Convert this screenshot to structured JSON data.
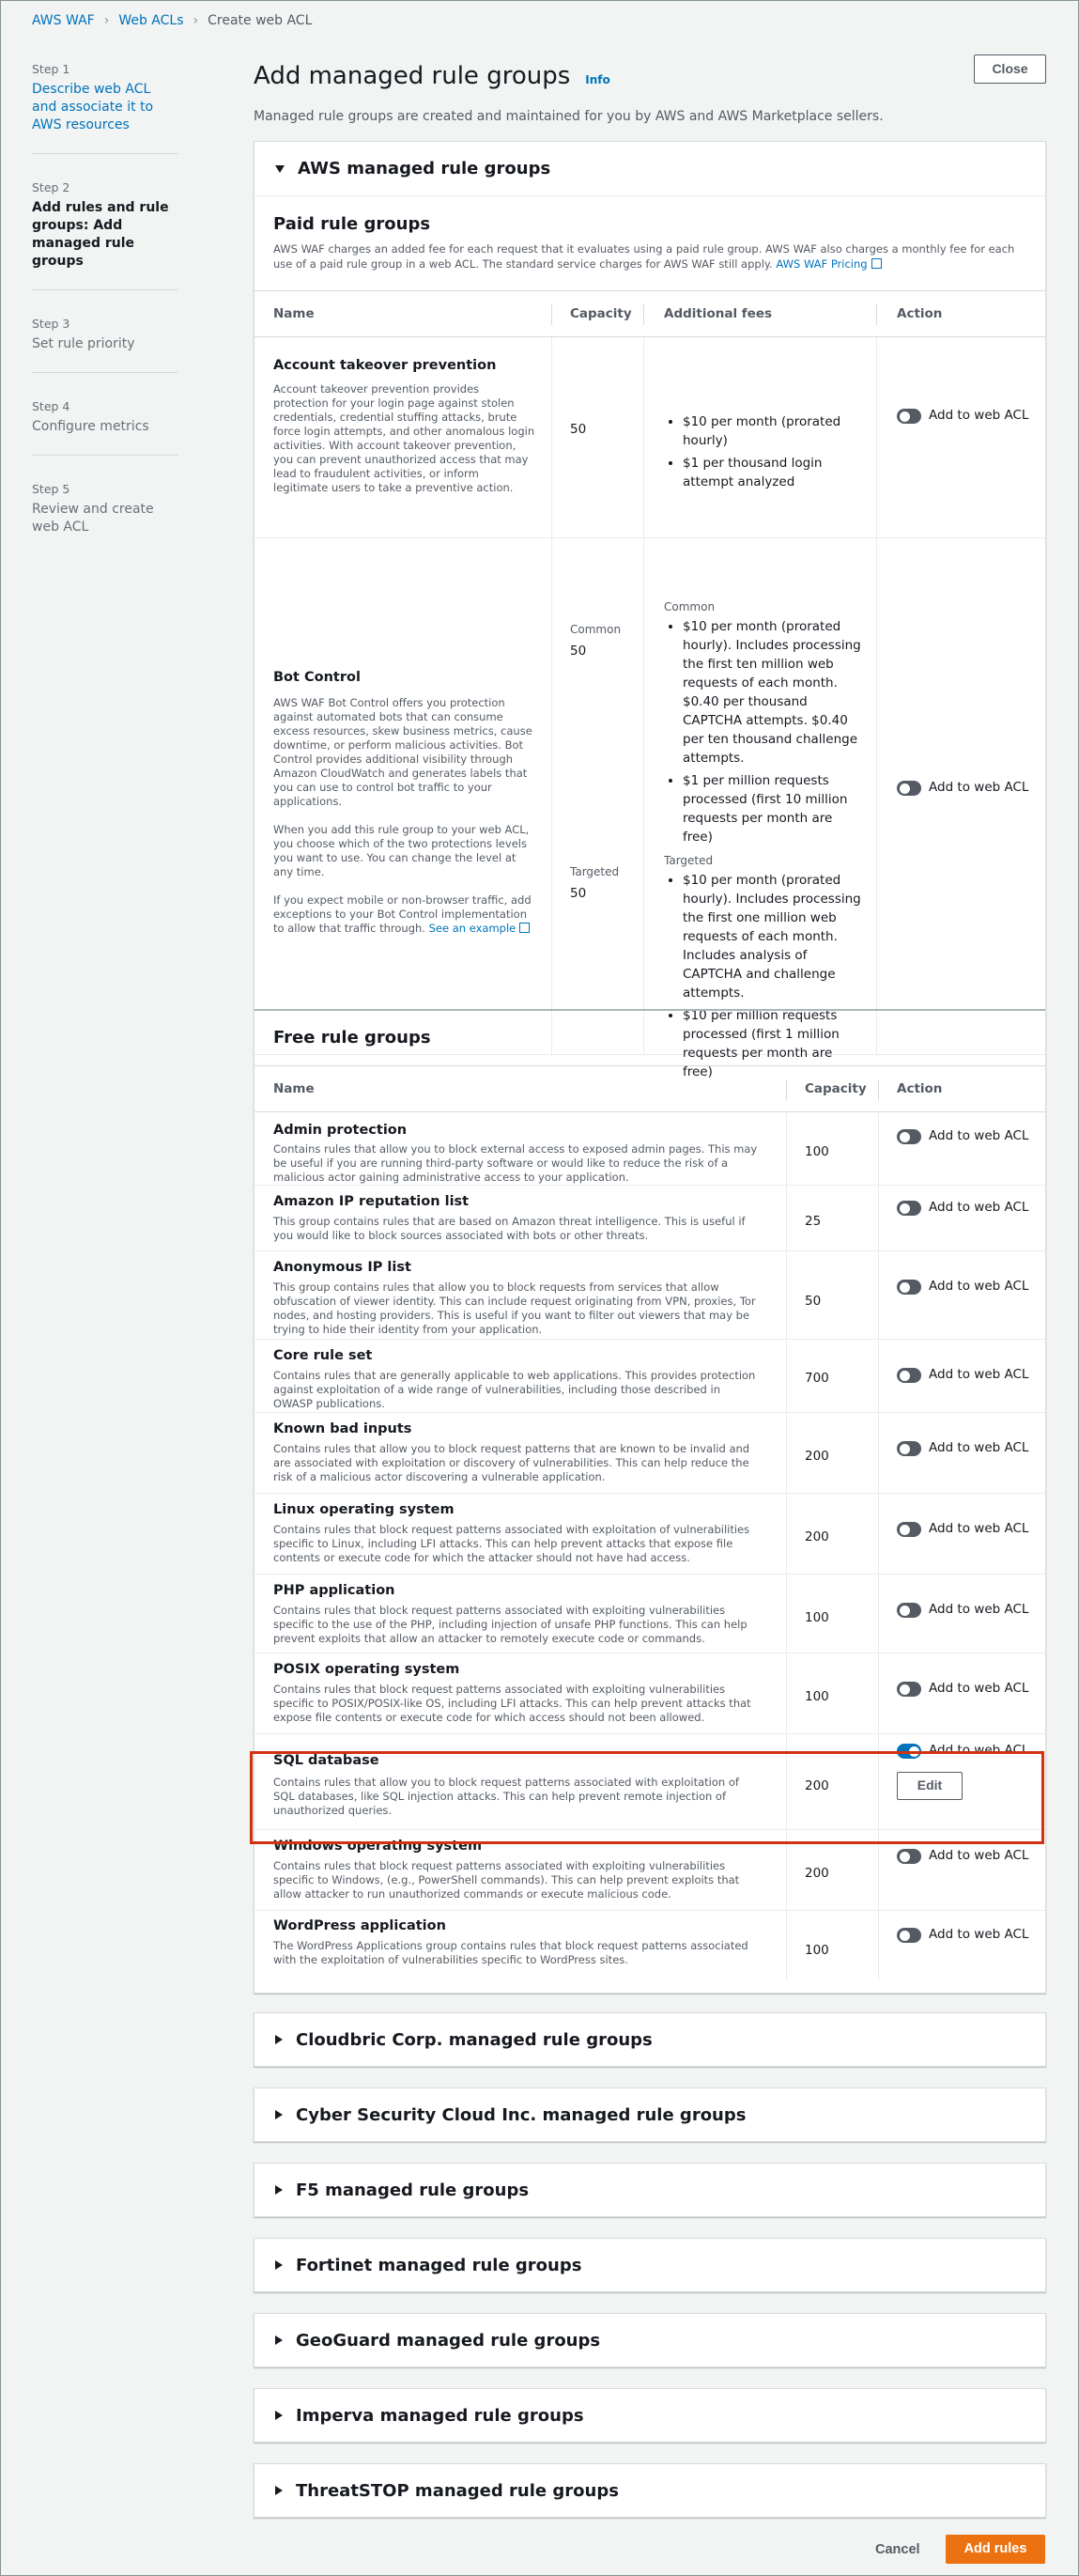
{
  "breadcrumb": [
    "AWS WAF",
    "Web ACLs",
    "Create web ACL"
  ],
  "steps": [
    {
      "num": "Step 1",
      "title": "Describe web ACL and associate it to AWS resources"
    },
    {
      "num": "Step 2",
      "title": "Add rules and rule groups: Add managed rule groups"
    },
    {
      "num": "Step 3",
      "title": "Set rule priority"
    },
    {
      "num": "Step 4",
      "title": "Configure metrics"
    },
    {
      "num": "Step 5",
      "title": "Review and create web ACL"
    }
  ],
  "page": {
    "title": "Add managed rule groups",
    "info": "Info",
    "close": "Close",
    "description": "Managed rule groups are created and maintained for you by AWS and AWS Marketplace sellers."
  },
  "aws_section": {
    "title": "AWS managed rule groups",
    "paid": {
      "title": "Paid rule groups",
      "description": "AWS WAF charges an added fee for each request that it evaluates using a paid rule group. AWS WAF also charges a monthly fee for each use of a paid rule group in a web ACL. The standard service charges for AWS WAF still apply.",
      "pricing_link": "AWS WAF Pricing",
      "columns": [
        "Name",
        "Capacity",
        "Additional fees",
        "Action"
      ],
      "rows": [
        {
          "name": "Account takeover prevention",
          "desc": "Account takeover prevention provides protection for your login page against stolen credentials, credential stuffing attacks, brute force login attempts, and other anomalous login activities. With account takeover prevention, you can prevent unauthorized access that may lead to fraudulent activities, or inform legitimate users to take a preventive action.",
          "capacity": "50",
          "fees": [
            "$10 per month (prorated hourly)",
            "$1 per thousand login attempt analyzed"
          ],
          "action": "Add to web ACL"
        },
        {
          "name": "Bot Control",
          "desc1": "AWS WAF Bot Control offers you protection against automated bots that can consume excess resources, skew business metrics, cause downtime, or perform malicious activities. Bot Control provides additional visibility through Amazon CloudWatch and generates labels that you can use to control bot traffic to your applications.",
          "desc2": "When you add this rule group to your web ACL, you choose which of the two protections levels you want to use. You can change the level at any time.",
          "desc3": "If you expect mobile or non-browser traffic, add exceptions to your Bot Control implementation to allow that traffic through.",
          "example_link": "See an example",
          "common_label": "Common",
          "common_capacity": "50",
          "common_fees": [
            "$10 per month (prorated hourly). Includes processing the first ten million web requests of each month. $0.40 per thousand CAPTCHA attempts. $0.40 per ten thousand challenge attempts.",
            "$1 per million requests processed (first 10 million requests per month are free)"
          ],
          "targeted_label": "Targeted",
          "targeted_capacity": "50",
          "targeted_fees": [
            "$10 per month (prorated hourly). Includes processing the first one million web requests of each month. Includes analysis of CAPTCHA and challenge attempts.",
            "$10 per million requests processed (first 1 million requests per month are free)"
          ],
          "action": "Add to web ACL"
        }
      ]
    },
    "free": {
      "title": "Free rule groups",
      "columns": [
        "Name",
        "Capacity",
        "Action"
      ],
      "rows": [
        {
          "name": "Admin protection",
          "desc": "Contains rules that allow you to block external access to exposed admin pages. This may be useful if you are running third-party software or would like to reduce the risk of a malicious actor gaining administrative access to your application.",
          "capacity": "100",
          "action": "Add to web ACL",
          "on": false
        },
        {
          "name": "Amazon IP reputation list",
          "desc": "This group contains rules that are based on Amazon threat intelligence. This is useful if you would like to block sources associated with bots or other threats.",
          "capacity": "25",
          "action": "Add to web ACL",
          "on": false
        },
        {
          "name": "Anonymous IP list",
          "desc": "This group contains rules that allow you to block requests from services that allow obfuscation of viewer identity. This can include request originating from VPN, proxies, Tor nodes, and hosting providers. This is useful if you want to filter out viewers that may be trying to hide their identity from your application.",
          "capacity": "50",
          "action": "Add to web ACL",
          "on": false
        },
        {
          "name": "Core rule set",
          "desc": "Contains rules that are generally applicable to web applications. This provides protection against exploitation of a wide range of vulnerabilities, including those described in OWASP publications.",
          "capacity": "700",
          "action": "Add to web ACL",
          "on": false
        },
        {
          "name": "Known bad inputs",
          "desc": "Contains rules that allow you to block request patterns that are known to be invalid and are associated with exploitation or discovery of vulnerabilities. This can help reduce the risk of a malicious actor discovering a vulnerable application.",
          "capacity": "200",
          "action": "Add to web ACL",
          "on": false
        },
        {
          "name": "Linux operating system",
          "desc": "Contains rules that block request patterns associated with exploitation of vulnerabilities specific to Linux, including LFI attacks. This can help prevent attacks that expose file contents or execute code for which the attacker should not have had access.",
          "capacity": "200",
          "action": "Add to web ACL",
          "on": false
        },
        {
          "name": "PHP application",
          "desc": "Contains rules that block request patterns associated with exploiting vulnerabilities specific to the use of the PHP, including injection of unsafe PHP functions. This can help prevent exploits that allow an attacker to remotely execute code or commands.",
          "capacity": "100",
          "action": "Add to web ACL",
          "on": false
        },
        {
          "name": "POSIX operating system",
          "desc": "Contains rules that block request patterns associated with exploiting vulnerabilities specific to POSIX/POSIX-like OS, including LFI attacks. This can help prevent attacks that expose file contents or execute code for which access should not been allowed.",
          "capacity": "100",
          "action": "Add to web ACL",
          "on": false
        },
        {
          "name": "SQL database",
          "desc": "Contains rules that allow you to block request patterns associated with exploitation of SQL databases, like SQL injection attacks. This can help prevent remote injection of unauthorized queries.",
          "capacity": "200",
          "action": "Add to web ACL",
          "on": true,
          "edit": "Edit"
        },
        {
          "name": "Windows operating system",
          "desc": "Contains rules that block request patterns associated with exploiting vulnerabilities specific to Windows, (e.g., PowerShell commands). This can help prevent exploits that allow attacker to run unauthorized commands or execute malicious code.",
          "capacity": "200",
          "action": "Add to web ACL",
          "on": false
        },
        {
          "name": "WordPress application",
          "desc": "The WordPress Applications group contains rules that block request patterns associated with the exploitation of vulnerabilities specific to WordPress sites.",
          "capacity": "100",
          "action": "Add to web ACL",
          "on": false
        }
      ]
    }
  },
  "vendor_sections": [
    "Cloudbric Corp. managed rule groups",
    "Cyber Security Cloud Inc. managed rule groups",
    "F5 managed rule groups",
    "Fortinet managed rule groups",
    "GeoGuard managed rule groups",
    "Imperva managed rule groups",
    "ThreatSTOP managed rule groups"
  ],
  "footer": {
    "cancel": "Cancel",
    "add_rules": "Add rules"
  },
  "colors": {
    "accent": "#0073bb",
    "primary_button": "#ec7211",
    "highlight": "#d13212"
  }
}
